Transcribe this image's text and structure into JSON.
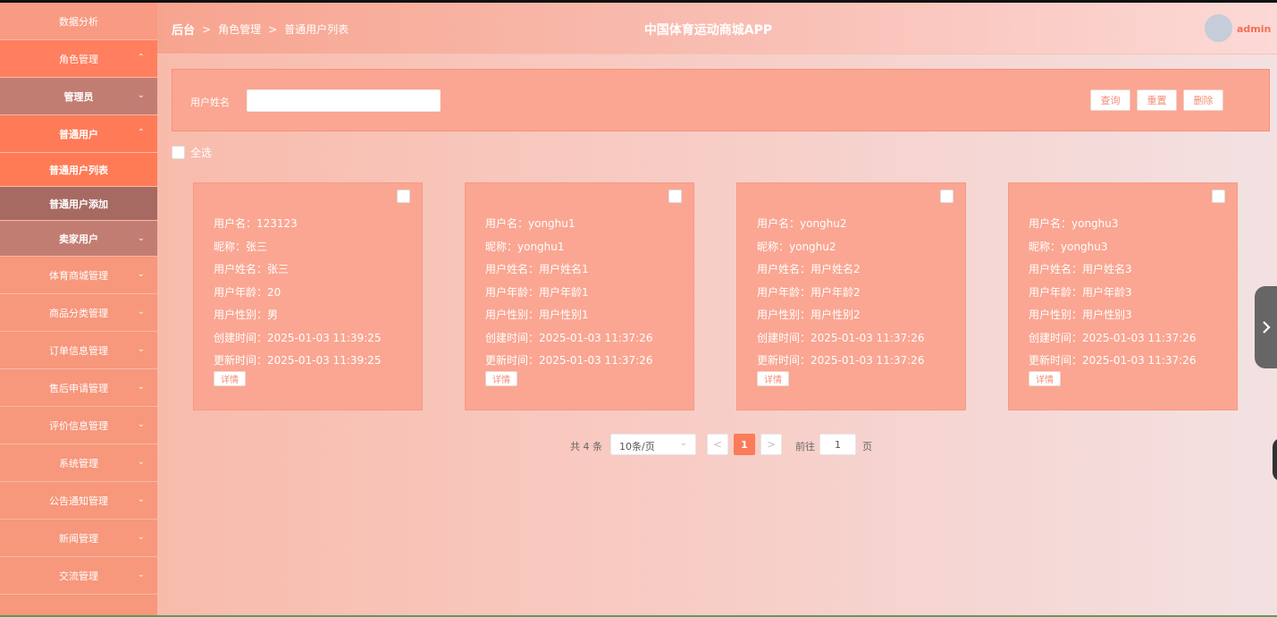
{
  "sidebar": {
    "items": [
      {
        "label": "数据分析",
        "chevron": ""
      },
      {
        "label": "角色管理",
        "chevron": "⌃"
      },
      {
        "label": "管理员",
        "chevron": "⌄"
      },
      {
        "label": "普通用户",
        "chevron": "⌃"
      },
      {
        "label": "普通用户列表",
        "chevron": ""
      },
      {
        "label": "普通用户添加",
        "chevron": ""
      },
      {
        "label": "卖家用户",
        "chevron": "⌄"
      },
      {
        "label": "体育商城管理",
        "chevron": "⌄"
      },
      {
        "label": "商品分类管理",
        "chevron": "⌄"
      },
      {
        "label": "订单信息管理",
        "chevron": "⌄"
      },
      {
        "label": "售后申请管理",
        "chevron": "⌄"
      },
      {
        "label": "评价信息管理",
        "chevron": "⌄"
      },
      {
        "label": "系统管理",
        "chevron": "⌄"
      },
      {
        "label": "公告通知管理",
        "chevron": "⌄"
      },
      {
        "label": "新闻管理",
        "chevron": "⌄"
      },
      {
        "label": "交流管理",
        "chevron": "⌄"
      }
    ]
  },
  "header": {
    "breadcrumb": [
      "后台",
      "角色管理",
      "普通用户列表"
    ],
    "separator": ">",
    "title": "中国体育运动商城APP",
    "user": "admin"
  },
  "search": {
    "label": "用户姓名",
    "value": "",
    "buttons": {
      "query": "查询",
      "reset": "重置",
      "delete": "删除"
    }
  },
  "select_all": "全选",
  "cards": [
    {
      "lines": [
        "用户名：123123",
        "昵称：张三",
        "用户姓名：张三",
        "用户年龄：20",
        "用户性别：男",
        "创建时间：2025-01-03 11:39:25",
        "更新时间：2025-01-03 11:39:25"
      ],
      "detail": "详情"
    },
    {
      "lines": [
        "用户名：yonghu1",
        "昵称：yonghu1",
        "用户姓名：用户姓名1",
        "用户年龄：用户年龄1",
        "用户性别：用户性别1",
        "创建时间：2025-01-03 11:37:26",
        "更新时间：2025-01-03 11:37:26"
      ],
      "detail": "详情"
    },
    {
      "lines": [
        "用户名：yonghu2",
        "昵称：yonghu2",
        "用户姓名：用户姓名2",
        "用户年龄：用户年龄2",
        "用户性别：用户性别2",
        "创建时间：2025-01-03 11:37:26",
        "更新时间：2025-01-03 11:37:26"
      ],
      "detail": "详情"
    },
    {
      "lines": [
        "用户名：yonghu3",
        "昵称：yonghu3",
        "用户姓名：用户姓名3",
        "用户年龄：用户年龄3",
        "用户性别：用户性别3",
        "创建时间：2025-01-03 11:37:26",
        "更新时间：2025-01-03 11:37:26"
      ],
      "detail": "详情"
    }
  ],
  "pagination": {
    "total": "共 4 条",
    "page_size": "10条/页",
    "prev": "<",
    "current": "1",
    "next": ">",
    "goto_label": "前往",
    "goto_value": "1",
    "page_unit": "页"
  },
  "icons": {
    "dropdown": "chevron-down-icon",
    "side_handle": "chevron-right-icon"
  },
  "colors": {
    "accent": "#fb7c59",
    "sidebar": "#f7977c",
    "card": "#faa692"
  }
}
